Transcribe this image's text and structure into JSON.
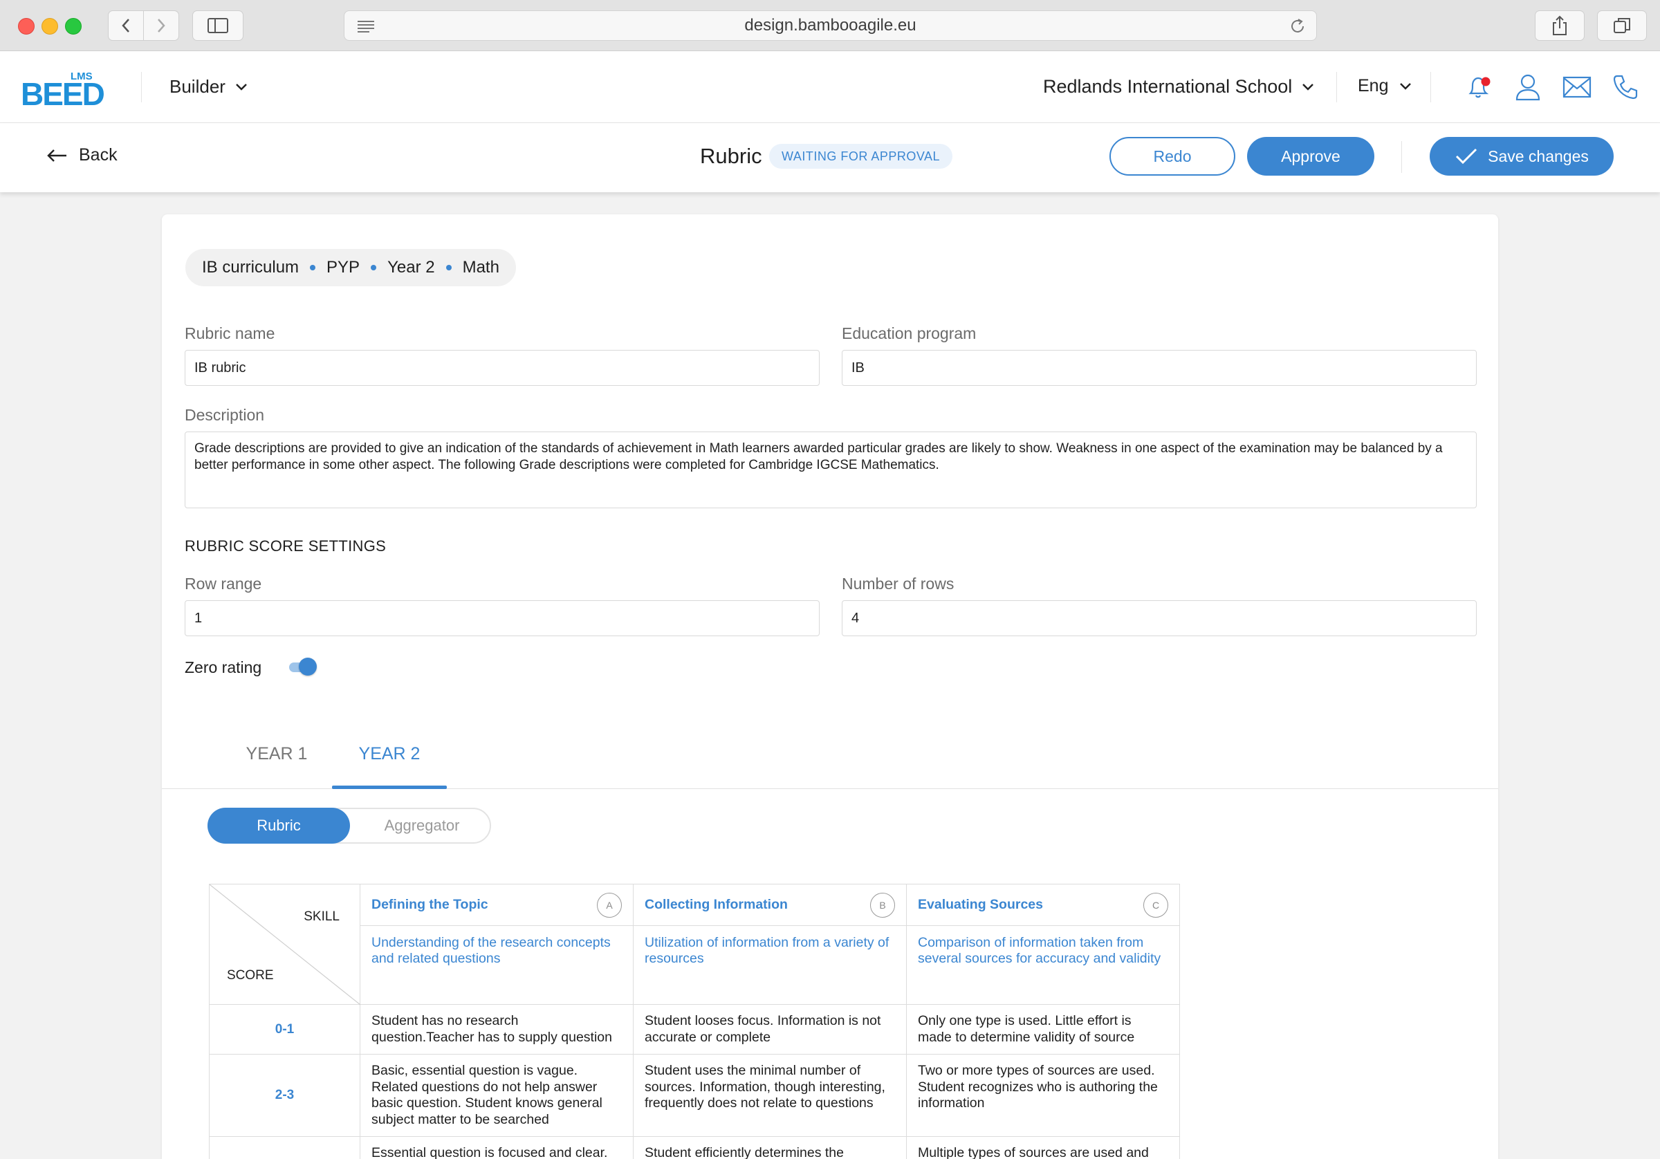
{
  "browser": {
    "url": "design.bambooagile.eu"
  },
  "header": {
    "logo_text": "BEED",
    "logo_badge": "LMS",
    "workspace": "Builder",
    "school": "Redlands International School",
    "language": "Eng",
    "icons": [
      "bell-icon",
      "user-icon",
      "mail-icon",
      "phone-icon"
    ],
    "accent_color": "#3b86d1",
    "notification_dot_color": "#e8232d"
  },
  "subheader": {
    "back_label": "Back",
    "title": "Rubric",
    "status": "WAITING FOR APPROVAL",
    "redo_label": "Redo",
    "approve_label": "Approve",
    "save_label": "Save changes"
  },
  "breadcrumb": [
    "IB curriculum",
    "PYP",
    "Year 2",
    "Math"
  ],
  "form": {
    "rubric_name_label": "Rubric name",
    "rubric_name_value": "IB rubric",
    "education_program_label": "Education program",
    "education_program_value": "IB",
    "description_label": "Description",
    "description_value": "Grade descriptions are provided to give an indication of the standards of achievement in Math learners awarded particular grades are likely to show. Weakness in one aspect of the examination may be balanced by a better performance in some other aspect. The following Grade descriptions were completed for Cambridge IGCSE Mathematics.",
    "score_settings_title": "RUBRIC SCORE SETTINGS",
    "row_range_label": "Row range",
    "row_range_value": "1",
    "number_of_rows_label": "Number of rows",
    "number_of_rows_value": "4",
    "zero_rating_label": "Zero rating",
    "zero_rating_on": true
  },
  "tabs": [
    {
      "label": "YEAR 1",
      "active": false
    },
    {
      "label": "YEAR 2",
      "active": true
    }
  ],
  "view_toggle": {
    "active": "Rubric",
    "inactive": "Aggregator"
  },
  "rubric_table": {
    "corner_skill": "SKILL",
    "corner_score": "SCORE",
    "skills": [
      {
        "name": "Defining the Topic",
        "letter": "A",
        "description": "Understanding of the research concepts and related questions"
      },
      {
        "name": "Collecting Information",
        "letter": "B",
        "description": "Utilization of information from a variety of resources"
      },
      {
        "name": "Evaluating Sources",
        "letter": "C",
        "description": "Comparison of information taken from several sources for accuracy and validity"
      }
    ],
    "rows": [
      {
        "score": "0-1",
        "cells": [
          "Student has no research question.Teacher has to supply question",
          "Student looses focus. Information is not accurate or complete",
          "Only one type is used. Little effort is made to determine validity of source"
        ]
      },
      {
        "score": "2-3",
        "cells": [
          "Basic, essential question is vague. Related questions do not help answer basic question. Student knows general subject matter to be searched",
          "Student uses the minimal number of sources. Information, though interesting, frequently does not relate to questions",
          "Two or more types of sources are used. Student recognizes who is authoring the information"
        ]
      },
      {
        "score": "",
        "cells": [
          "Essential question is focused and clear.",
          "Student efficiently determines the",
          "Multiple types of sources are used and"
        ]
      }
    ]
  }
}
